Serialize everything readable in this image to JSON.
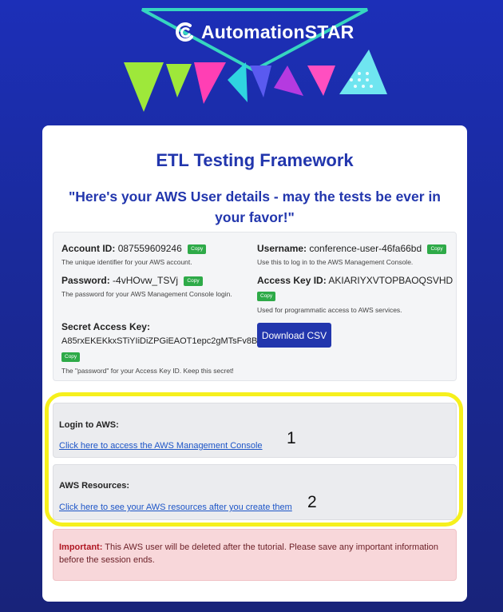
{
  "brand": {
    "name": "AutomationSTAR"
  },
  "header": {
    "title": "ETL Testing Framework",
    "subtitle": "\"Here's your AWS User details - may the tests be ever in your favor!\""
  },
  "account": {
    "label": "Account ID:",
    "value": "087559609246",
    "desc": "The unique identifier for your AWS account."
  },
  "username": {
    "label": "Username:",
    "value": "conference-user-46fa66bd",
    "desc": "Use this to log in to the AWS Management Console."
  },
  "password": {
    "label": "Password:",
    "value": "-4vHOvw_TSVj",
    "desc": "The password for your AWS Management Console login."
  },
  "access_key": {
    "label": "Access Key ID:",
    "value": "AKIARIYXVTOPBAOQSVHD",
    "desc": "Used for programmatic access to AWS services."
  },
  "secret_key": {
    "label": "Secret Access Key:",
    "value": "A85rxEKEKkxSTiYIiDiZPGiEAOT1epc2gMTsFv8B",
    "desc": "The \"password\" for your Access Key ID. Keep this secret!"
  },
  "copy_label": "Copy",
  "download_label": "Download CSV",
  "login": {
    "title": "Login to AWS:",
    "link": "Click here to access the AWS Management Console"
  },
  "resources": {
    "title": "AWS Resources:",
    "link": "Click here to see your AWS resources after you create them"
  },
  "annotations": {
    "one": "1",
    "two": "2"
  },
  "warning": {
    "strong": "Important:",
    "text": " This AWS user will be deleted after the tutorial. Please save any important information before the session ends."
  },
  "colors": {
    "brand_blue": "#2236ad",
    "copy_green": "#2eaa48",
    "highlight_yellow": "#f6f01c",
    "warning_bg": "#f8d7da"
  }
}
